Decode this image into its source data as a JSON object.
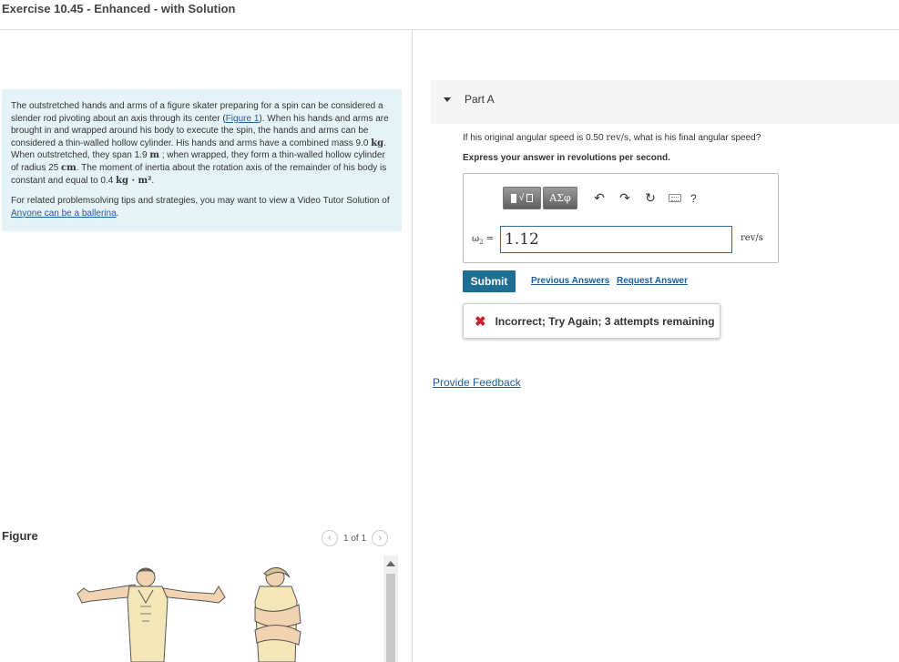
{
  "page": {
    "title": "Exercise 10.45 - Enhanced - with Solution"
  },
  "problem": {
    "text_1": "The outstretched hands and arms of a figure skater preparing for a spin can be considered a slender rod pivoting about an axis through its center (",
    "figure_link": "Figure 1",
    "text_2": "). When his hands and arms are brought in and wrapped around his body to execute the spin, the hands and arms can be considered a thin-walled hollow cylinder. His hands and arms have a combined mass 9.0 ",
    "unit_kg": "kg",
    "text_3": ". When outstretched, they span 1.9 ",
    "unit_m": "m",
    "text_4": " ; when wrapped, they form a thin-walled hollow cylinder of radius 25 ",
    "unit_cm": "cm",
    "text_5": ". The moment of inertia about the rotation axis of the remainder of his body is constant and equal to 0.4 ",
    "unit_kgm2": "kg · m²",
    "text_6": ".",
    "tips_text": "For related problemsolving tips and strategies, you may want to view a Video Tutor Solution of ",
    "tips_link": "Anyone can be a ballerina",
    "tips_end": "."
  },
  "figure": {
    "label": "Figure",
    "pager": "1 of 1",
    "prev_icon": "chevron-left-icon",
    "next_icon": "chevron-right-icon"
  },
  "part_a": {
    "title": "Part A",
    "question_1": "If his original angular speed is 0.50 ",
    "question_unit": "rev/s",
    "question_2": ", what is his final angular speed?",
    "instruction": "Express your answer in revolutions per second.",
    "toolbar": {
      "templates_root": "√",
      "symbols": "ΑΣφ",
      "undo_icon": "undo-icon",
      "redo_icon": "redo-icon",
      "reset_icon": "reset-icon",
      "keyboard_icon": "keyboard-icon",
      "help": "?"
    },
    "variable": "ω",
    "variable_sub": "2",
    "equals": " =",
    "answer_value": "1.12",
    "unit": "rev/s",
    "submit": "Submit",
    "previous_answers": "Previous Answers",
    "request_answer": "Request Answer",
    "feedback_icon": "x-icon",
    "feedback": "Incorrect; Try Again; 3 attempts remaining",
    "error_color": "#c9202b"
  },
  "provide_feedback": "Provide Feedback",
  "colors": {
    "problem_bg": "#e6f3f6",
    "link": "#1a5fa0",
    "submit_bg": "#1e6e94"
  }
}
